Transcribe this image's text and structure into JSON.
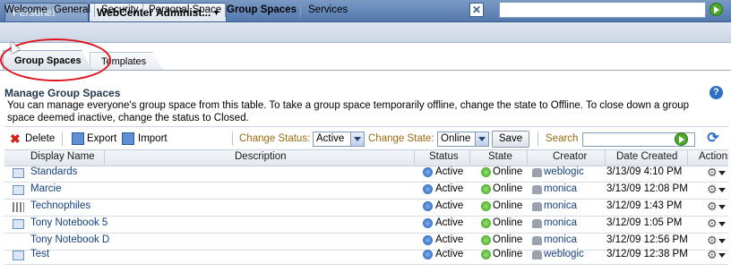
{
  "top_tabs": {
    "personal_space": "Personal Space",
    "admin": "WebCenter Administ..."
  },
  "nav": [
    "Welcome",
    "General",
    "Security",
    "Personal Space",
    "Group Spaces",
    "Services"
  ],
  "sub_tabs": {
    "group_spaces": "Group Spaces",
    "templates": "Templates"
  },
  "page": {
    "title": "Manage Group Spaces",
    "description": "You can manage everyone's group space from this table. To take a group space temporarily offline, change the state to Offline. To close down a group space deemed inactive, change the status to Closed."
  },
  "toolbar": {
    "delete": "Delete",
    "export": "Export",
    "import": "Import",
    "change_status_label": "Change Status:",
    "status_value": "Active",
    "change_state_label": "Change State:",
    "state_value": "Online",
    "save": "Save",
    "search_label": "Search"
  },
  "columns": [
    "Display Name",
    "Description",
    "Status",
    "State",
    "Creator",
    "Date Created",
    "Actions"
  ],
  "rows": [
    {
      "name": "Standards",
      "status": "Active",
      "state": "Online",
      "creator": "weblogic",
      "date": "3/13/09 4:10 PM"
    },
    {
      "name": "Marcie",
      "status": "Active",
      "state": "Online",
      "creator": "monica",
      "date": "3/13/09 12:08 PM"
    },
    {
      "name": "Technophiles",
      "status": "Active",
      "state": "Online",
      "creator": "monica",
      "date": "3/12/09 1:43 PM"
    },
    {
      "name": "Tony Notebook 5",
      "status": "Active",
      "state": "Online",
      "creator": "monica",
      "date": "3/12/09 1:05 PM"
    },
    {
      "name": "Tony Notebook D",
      "status": "Active",
      "state": "Online",
      "creator": "monica",
      "date": "3/12/09 12:56 PM"
    },
    {
      "name": "Test",
      "status": "Active",
      "state": "Online",
      "creator": "weblogic",
      "date": "3/12/09 12:38 PM"
    }
  ],
  "colors": {
    "link": "#14407c",
    "highlight_circle": "#e0141c",
    "toolbar_label": "#9c6b13"
  }
}
